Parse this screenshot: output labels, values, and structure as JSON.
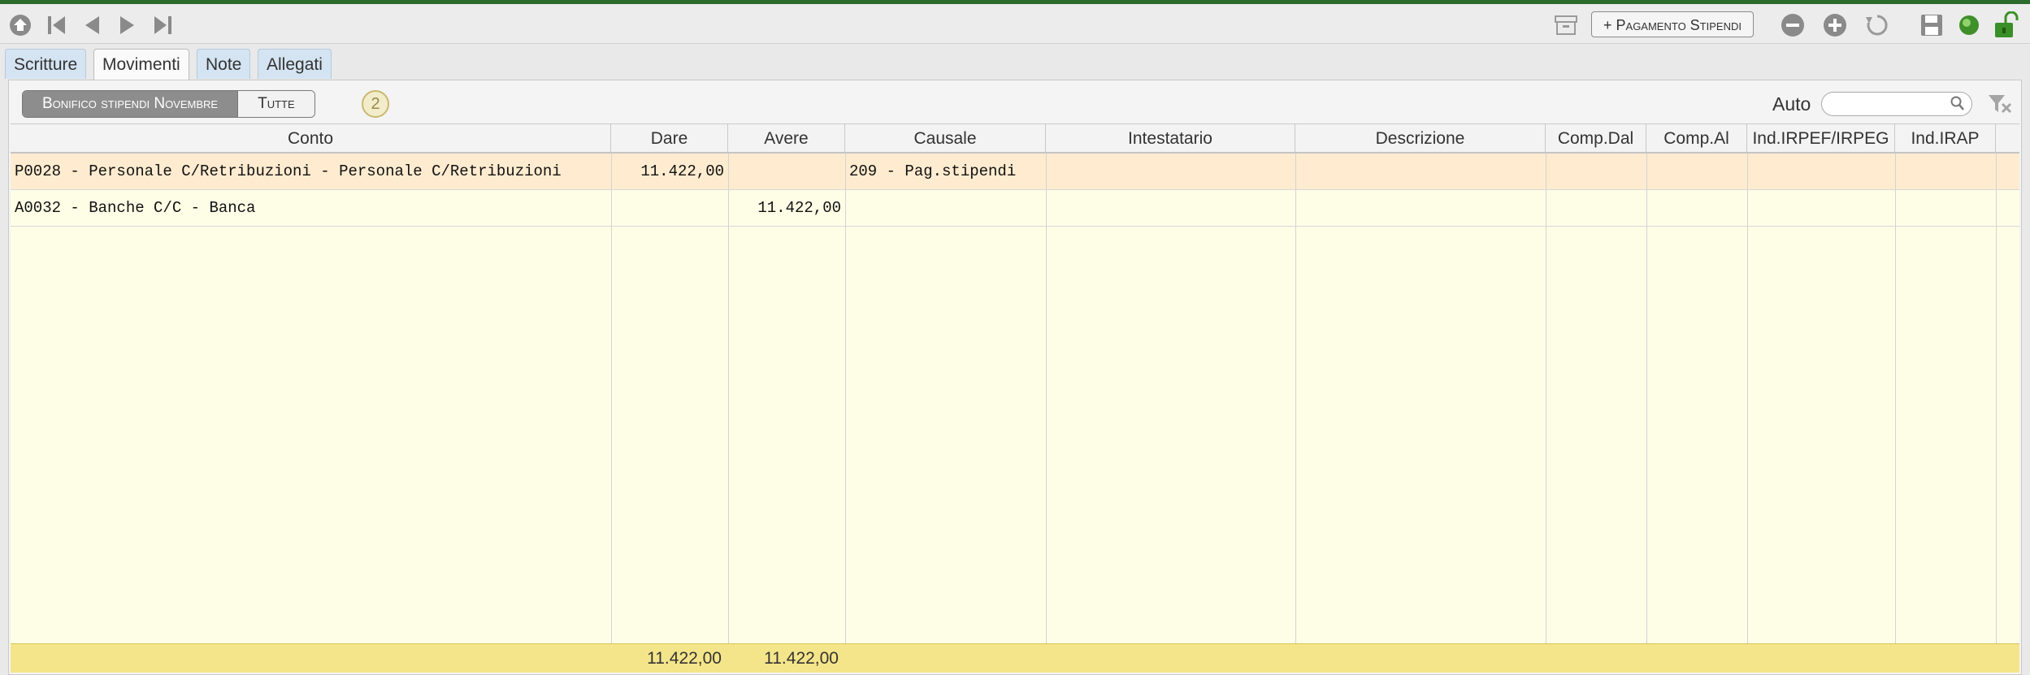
{
  "toolbar": {
    "pagamento_label": "+ Pagamento Stipendi"
  },
  "tabs": [
    {
      "label": "Scritture"
    },
    {
      "label": "Movimenti"
    },
    {
      "label": "Note"
    },
    {
      "label": "Allegati"
    }
  ],
  "filter": {
    "selected": "Bonifico stipendi Novembre",
    "other": "Tutte",
    "count": "2",
    "auto_label": "Auto",
    "search_value": ""
  },
  "grid": {
    "columns": [
      "Conto",
      "Dare",
      "Avere",
      "Causale",
      "Intestatario",
      "Descrizione",
      "Comp.Dal",
      "Comp.Al",
      "Ind.IRPEF/IRPEG",
      "Ind.IRAP"
    ],
    "rows": [
      {
        "conto": "P0028 - Personale C/Retribuzioni - Personale C/Retribuzioni",
        "dare": "11.422,00",
        "avere": "",
        "causale": "209 - Pag.stipendi"
      },
      {
        "conto": "A0032 - Banche C/C - Banca",
        "dare": "",
        "avere": "11.422,00",
        "causale": ""
      }
    ],
    "totals": {
      "dare": "11.422,00",
      "avere": "11.422,00"
    }
  },
  "colors": {
    "accent_top": "#2d6b2d",
    "row_highlight": "#ffecd0",
    "grid_bg": "#fefee7",
    "totals_bg": "#f5e58a"
  }
}
